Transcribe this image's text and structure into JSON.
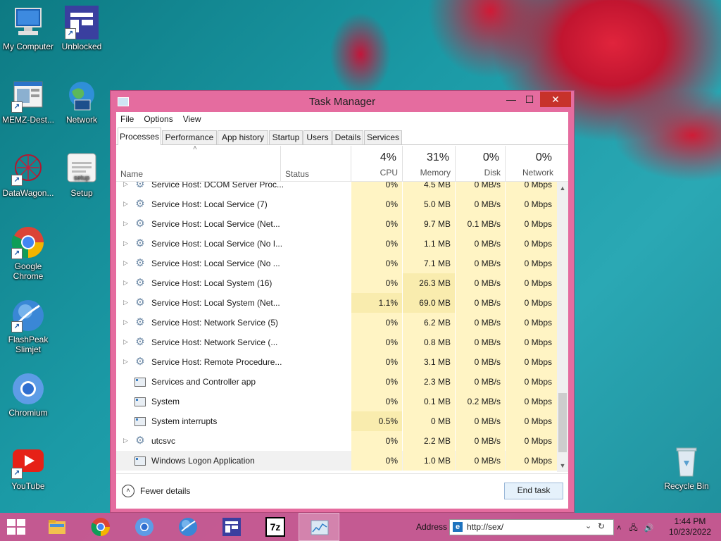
{
  "desktop": {
    "icons": [
      {
        "label": "My Computer",
        "icon": "computer-icon"
      },
      {
        "label": "Unblocked",
        "icon": "app-icon"
      },
      {
        "label": "MEMZ-Dest...",
        "icon": "window-icon"
      },
      {
        "label": "Network",
        "icon": "globe-icon"
      },
      {
        "label": "DataWagon...",
        "icon": "network-graph-icon"
      },
      {
        "label": "Setup",
        "icon": "setup-icon"
      },
      {
        "label": "Google Chrome",
        "icon": "chrome-icon"
      },
      {
        "label": "FlashPeak Slimjet",
        "icon": "slimjet-icon"
      },
      {
        "label": "Chromium",
        "icon": "chromium-icon"
      },
      {
        "label": "YouTube",
        "icon": "youtube-icon"
      },
      {
        "label": "Recycle Bin",
        "icon": "recycle-bin-icon"
      }
    ],
    "setup_icon_text": "setup"
  },
  "task_manager": {
    "title": "Task Manager",
    "menu": [
      "File",
      "Options",
      "View"
    ],
    "tabs": [
      "Processes",
      "Performance",
      "App history",
      "Startup",
      "Users",
      "Details",
      "Services"
    ],
    "active_tab": "Processes",
    "columns": {
      "name": "Name",
      "status": "Status",
      "cpu": {
        "pct": "4%",
        "label": "CPU"
      },
      "memory": {
        "pct": "31%",
        "label": "Memory"
      },
      "disk": {
        "pct": "0%",
        "label": "Disk"
      },
      "network": {
        "pct": "0%",
        "label": "Network"
      }
    },
    "rows": [
      {
        "name": "Service Host: DCOM Server Proc...",
        "type": "service",
        "expandable": true,
        "cpu": "0%",
        "memory": "4.5 MB",
        "disk": "0 MB/s",
        "network": "0 Mbps"
      },
      {
        "name": "Service Host: Local Service (7)",
        "type": "service",
        "expandable": true,
        "cpu": "0%",
        "memory": "5.0 MB",
        "disk": "0 MB/s",
        "network": "0 Mbps"
      },
      {
        "name": "Service Host: Local Service (Net...",
        "type": "service",
        "expandable": true,
        "cpu": "0%",
        "memory": "9.7 MB",
        "disk": "0.1 MB/s",
        "network": "0 Mbps"
      },
      {
        "name": "Service Host: Local Service (No I...",
        "type": "service",
        "expandable": true,
        "cpu": "0%",
        "memory": "1.1 MB",
        "disk": "0 MB/s",
        "network": "0 Mbps"
      },
      {
        "name": "Service Host: Local Service (No ...",
        "type": "service",
        "expandable": true,
        "cpu": "0%",
        "memory": "7.1 MB",
        "disk": "0 MB/s",
        "network": "0 Mbps"
      },
      {
        "name": "Service Host: Local System (16)",
        "type": "service",
        "expandable": true,
        "cpu": "0%",
        "memory": "26.3 MB",
        "disk": "0 MB/s",
        "network": "0 Mbps"
      },
      {
        "name": "Service Host: Local System (Net...",
        "type": "service",
        "expandable": true,
        "cpu": "1.1%",
        "memory": "69.0 MB",
        "disk": "0 MB/s",
        "network": "0 Mbps"
      },
      {
        "name": "Service Host: Network Service (5)",
        "type": "service",
        "expandable": true,
        "cpu": "0%",
        "memory": "6.2 MB",
        "disk": "0 MB/s",
        "network": "0 Mbps"
      },
      {
        "name": "Service Host: Network Service (...",
        "type": "service",
        "expandable": true,
        "cpu": "0%",
        "memory": "0.8 MB",
        "disk": "0 MB/s",
        "network": "0 Mbps"
      },
      {
        "name": "Service Host: Remote Procedure...",
        "type": "service",
        "expandable": true,
        "cpu": "0%",
        "memory": "3.1 MB",
        "disk": "0 MB/s",
        "network": "0 Mbps"
      },
      {
        "name": "Services and Controller app",
        "type": "app",
        "expandable": false,
        "cpu": "0%",
        "memory": "2.3 MB",
        "disk": "0 MB/s",
        "network": "0 Mbps"
      },
      {
        "name": "System",
        "type": "app",
        "expandable": false,
        "cpu": "0%",
        "memory": "0.1 MB",
        "disk": "0.2 MB/s",
        "network": "0 Mbps"
      },
      {
        "name": "System interrupts",
        "type": "app",
        "expandable": false,
        "cpu": "0.5%",
        "memory": "0 MB",
        "disk": "0 MB/s",
        "network": "0 Mbps"
      },
      {
        "name": "utcsvc",
        "type": "service",
        "expandable": true,
        "cpu": "0%",
        "memory": "2.2 MB",
        "disk": "0 MB/s",
        "network": "0 Mbps"
      },
      {
        "name": "Windows Logon Application",
        "type": "app",
        "expandable": false,
        "cpu": "0%",
        "memory": "1.0 MB",
        "disk": "0 MB/s",
        "network": "0 Mbps",
        "selected": true
      }
    ],
    "fewer_details": "Fewer details",
    "end_task": "End task"
  },
  "taskbar": {
    "apps": [
      "file-explorer-icon",
      "chrome-icon",
      "chromium-icon",
      "slimjet-icon",
      "unblocked-icon",
      "7zip-icon",
      "task-manager-icon"
    ],
    "seven_zip_text": "7z",
    "address_label": "Address",
    "address_value": "http://sex/",
    "time": "1:44 PM",
    "date": "10/23/2022"
  },
  "colors": {
    "window_frame": "#e56c9f",
    "taskbar": "#d1548f",
    "cpu_heat": "#fff4c4",
    "close_button": "#c7322b"
  }
}
